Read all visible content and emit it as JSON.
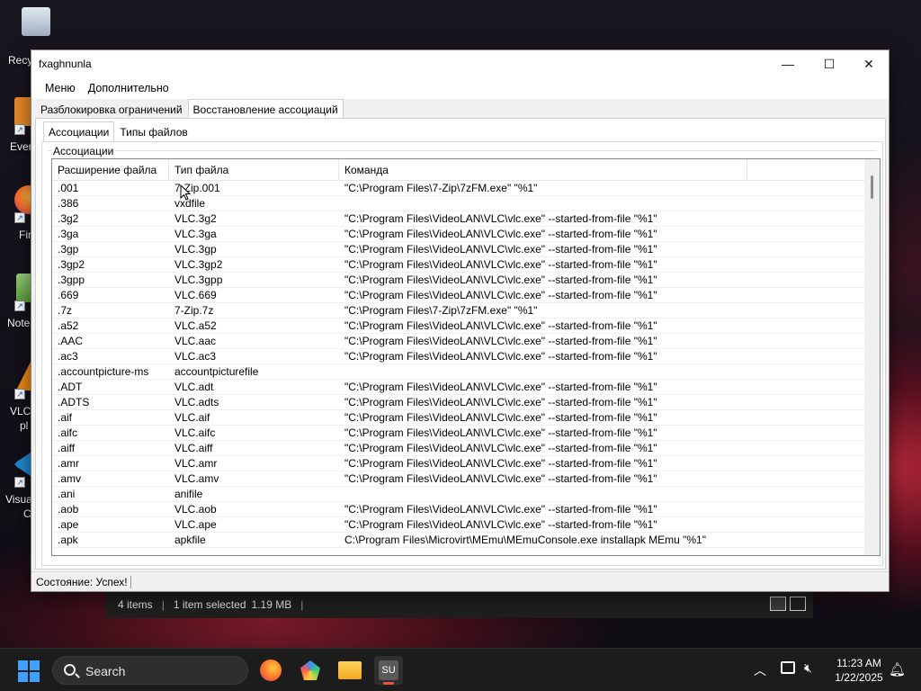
{
  "desktop": {
    "icons": [
      {
        "label": "Recy"
      },
      {
        "label": "Ever"
      },
      {
        "label": "Fir"
      },
      {
        "label": "Note"
      },
      {
        "label": "VLC",
        "label2": "pl"
      },
      {
        "label": "Visua",
        "label2": "C"
      }
    ]
  },
  "explorer_status": {
    "items_count": "4 items",
    "selection": "1 item selected",
    "size": "1.19 MB"
  },
  "window": {
    "title": "fxaghnunla",
    "minimize_glyph": "—",
    "maximize_glyph": "☐",
    "close_glyph": "✕",
    "menu": [
      "Меню",
      "Дополнительно"
    ],
    "top_tabs": [
      "Разблокировка ограничений",
      "Восстановление ассоциаций"
    ],
    "inner_tabs": [
      "Ассоциации",
      "Типы файлов"
    ],
    "group_label": "Ассоциации",
    "columns": [
      "Расширение файла",
      "Тип файла",
      "Команда",
      ""
    ],
    "rows": [
      [
        ".001",
        "7-Zip.001",
        "\"C:\\Program Files\\7-Zip\\7zFM.exe\" \"%1\""
      ],
      [
        ".386",
        "vxdfile",
        ""
      ],
      [
        ".3g2",
        "VLC.3g2",
        "\"C:\\Program Files\\VideoLAN\\VLC\\vlc.exe\" --started-from-file \"%1\""
      ],
      [
        ".3ga",
        "VLC.3ga",
        "\"C:\\Program Files\\VideoLAN\\VLC\\vlc.exe\" --started-from-file \"%1\""
      ],
      [
        ".3gp",
        "VLC.3gp",
        "\"C:\\Program Files\\VideoLAN\\VLC\\vlc.exe\" --started-from-file \"%1\""
      ],
      [
        ".3gp2",
        "VLC.3gp2",
        "\"C:\\Program Files\\VideoLAN\\VLC\\vlc.exe\" --started-from-file \"%1\""
      ],
      [
        ".3gpp",
        "VLC.3gpp",
        "\"C:\\Program Files\\VideoLAN\\VLC\\vlc.exe\" --started-from-file \"%1\""
      ],
      [
        ".669",
        "VLC.669",
        "\"C:\\Program Files\\VideoLAN\\VLC\\vlc.exe\" --started-from-file \"%1\""
      ],
      [
        ".7z",
        "7-Zip.7z",
        "\"C:\\Program Files\\7-Zip\\7zFM.exe\" \"%1\""
      ],
      [
        ".a52",
        "VLC.a52",
        "\"C:\\Program Files\\VideoLAN\\VLC\\vlc.exe\" --started-from-file \"%1\""
      ],
      [
        ".AAC",
        "VLC.aac",
        "\"C:\\Program Files\\VideoLAN\\VLC\\vlc.exe\" --started-from-file \"%1\""
      ],
      [
        ".ac3",
        "VLC.ac3",
        "\"C:\\Program Files\\VideoLAN\\VLC\\vlc.exe\" --started-from-file \"%1\""
      ],
      [
        ".accountpicture-ms",
        "accountpicturefile",
        ""
      ],
      [
        ".ADT",
        "VLC.adt",
        "\"C:\\Program Files\\VideoLAN\\VLC\\vlc.exe\" --started-from-file \"%1\""
      ],
      [
        ".ADTS",
        "VLC.adts",
        "\"C:\\Program Files\\VideoLAN\\VLC\\vlc.exe\" --started-from-file \"%1\""
      ],
      [
        ".aif",
        "VLC.aif",
        "\"C:\\Program Files\\VideoLAN\\VLC\\vlc.exe\" --started-from-file \"%1\""
      ],
      [
        ".aifc",
        "VLC.aifc",
        "\"C:\\Program Files\\VideoLAN\\VLC\\vlc.exe\" --started-from-file \"%1\""
      ],
      [
        ".aiff",
        "VLC.aiff",
        "\"C:\\Program Files\\VideoLAN\\VLC\\vlc.exe\" --started-from-file \"%1\""
      ],
      [
        ".amr",
        "VLC.amr",
        "\"C:\\Program Files\\VideoLAN\\VLC\\vlc.exe\" --started-from-file \"%1\""
      ],
      [
        ".amv",
        "VLC.amv",
        "\"C:\\Program Files\\VideoLAN\\VLC\\vlc.exe\" --started-from-file \"%1\""
      ],
      [
        ".ani",
        "anifile",
        ""
      ],
      [
        ".aob",
        "VLC.aob",
        "\"C:\\Program Files\\VideoLAN\\VLC\\vlc.exe\" --started-from-file \"%1\""
      ],
      [
        ".ape",
        "VLC.ape",
        "\"C:\\Program Files\\VideoLAN\\VLC\\vlc.exe\" --started-from-file \"%1\""
      ],
      [
        ".apk",
        "apkfile",
        "C:\\Program Files\\Microvirt\\MEmu\\MEmuConsole.exe installapk MEmu \"%1\""
      ]
    ],
    "status": "Состояние: Успех!"
  },
  "taskbar": {
    "search_label": "Search",
    "time": "11:23 AM",
    "date": "1/22/2025",
    "accent": "#3fa0ff"
  }
}
